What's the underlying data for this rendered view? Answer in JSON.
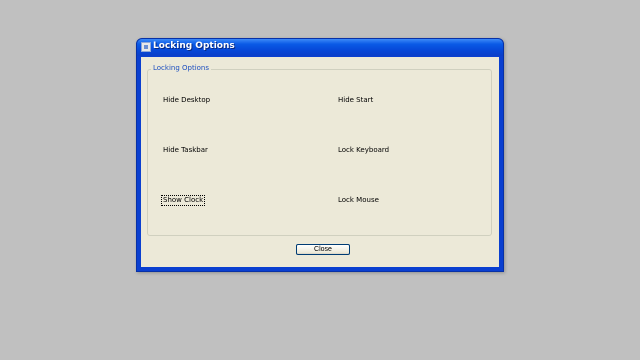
{
  "window": {
    "title": "Locking Options"
  },
  "group": {
    "legend": "Locking Options",
    "options": [
      {
        "label": "Hide Desktop"
      },
      {
        "label": "Hide Start"
      },
      {
        "label": "Hide Taskbar"
      },
      {
        "label": "Lock Keyboard"
      },
      {
        "label": "Show Clock"
      },
      {
        "label": "Lock Mouse"
      }
    ]
  },
  "buttons": {
    "close_label": "Close"
  },
  "icons": {
    "window_icon": "app-window-icon"
  },
  "colors": {
    "titlebar": "#0a5ae6",
    "dialog_background": "#ece9d8",
    "legend_text": "#1d4fc0",
    "desktop": "#c0c0c0"
  }
}
